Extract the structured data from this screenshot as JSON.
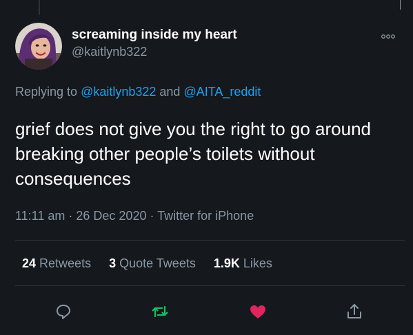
{
  "tweet": {
    "display_name": "screaming inside my heart",
    "handle": "@kaitlynb322",
    "reply_prefix": "Replying to ",
    "reply_to_1": "@kaitlynb322",
    "reply_joiner": " and ",
    "reply_to_2": "@AITA_reddit",
    "text": "grief does not give you the right to go around breaking other people’s toilets without consequences",
    "time": "11:11 am",
    "separator_1": " · ",
    "date": "26 Dec 2020",
    "separator_2": " · ",
    "source": "Twitter for iPhone"
  },
  "stats": {
    "retweets_count": "24",
    "retweets_label": " Retweets",
    "quote_count": "3",
    "quote_label": " Quote Tweets",
    "likes_count": "1.9K",
    "likes_label": " Likes"
  },
  "icons": {
    "more": "more-icon",
    "reply": "reply-icon",
    "retweet": "retweet-icon",
    "like": "like-icon",
    "share": "share-icon"
  },
  "colors": {
    "background": "#15181c",
    "text": "#ffffff",
    "muted": "#8899a6",
    "link": "#1da1f2",
    "retweet_active": "#17bf63",
    "like_active": "#e0245e"
  }
}
